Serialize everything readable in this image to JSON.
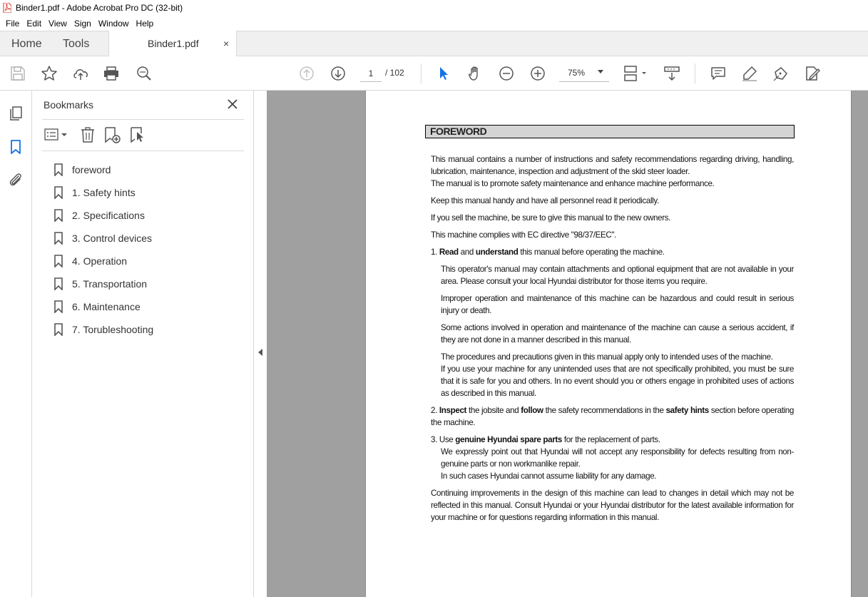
{
  "window": {
    "title": "Binder1.pdf - Adobe Acrobat Pro DC (32-bit)"
  },
  "menubar": {
    "items": [
      "File",
      "Edit",
      "View",
      "Sign",
      "Window",
      "Help"
    ]
  },
  "tabs": {
    "home": "Home",
    "tools": "Tools",
    "document": "Binder1.pdf",
    "close_symbol": "×"
  },
  "toolbar": {
    "page_current": "1",
    "page_total": "/ 102",
    "zoom": "75%"
  },
  "bookmarks": {
    "title": "Bookmarks",
    "items": [
      "foreword",
      "1. Safety hints",
      "2. Specifications",
      "3. Control devices",
      "4. Operation",
      "5. Transportation",
      "6. Maintenance",
      "7. Torubleshooting"
    ]
  },
  "document": {
    "heading": "FOREWORD",
    "p1": "This manual contains a number of instructions and safety recommendations regarding driving, handling, lubrication, maintenance, inspection and adjustment of the skid steer loader.",
    "p1b": "The manual is to promote safety maintenance and enhance machine performance.",
    "p2": "Keep this manual handy and have all personnel read it periodically.",
    "p3": "If you sell the machine, be sure to give this manual to the new owners.",
    "p4": "This machine complies with EC directive \"98/37/EEC\".",
    "item1": {
      "num": "1. ",
      "bold1": "Read",
      "mid": " and ",
      "bold2": "understand",
      "rest": " this manual before operating the machine."
    },
    "s1": "This operator's manual may contain attachments and optional equipment that are not available in your area.   Please consult your local Hyundai distributor for those items you require.",
    "s2": "Improper operation and maintenance of this machine can be hazardous and could result in serious injury or death.",
    "s3": "Some actions involved in operation and maintenance of the machine can cause a serious accident, if they are not done in a manner described in this manual.",
    "s4a": "The procedures and precautions given in this manual apply only to intended uses of the machine.",
    "s4b": "If you use your machine for any unintended uses that are not specifically prohibited, you must be sure that it is safe for you and others.   In no event should you or others engage in prohibited uses of actions as described in this manual.",
    "item2": {
      "num": "2. ",
      "bold1": "Inspect",
      "mid1": " the jobsite and ",
      "bold2": "follow",
      "mid2": " the safety recommendations in the ",
      "bold3": "safety hints",
      "rest": " section before operating the machine."
    },
    "item3": {
      "num": "3. Use ",
      "bold1": "genuine Hyundai spare parts",
      "rest": " for the replacement of parts."
    },
    "s5": "We expressly point out that Hyundai will not accept any responsibility for defects resulting from non-genuine parts or non workmanlike repair.",
    "s6": "In such cases Hyundai cannot assume liability for any damage.",
    "p5": "Continuing improvements in the design of this machine can lead to changes in detail which may not be reflected in this manual.   Consult Hyundai or your Hyundai distributor for the latest available information for your machine or for questions regarding information in this manual."
  },
  "colors": {
    "accent": "#1473e6",
    "panel_bg": "#f0f0f0",
    "doc_bg": "#a0a0a0"
  }
}
